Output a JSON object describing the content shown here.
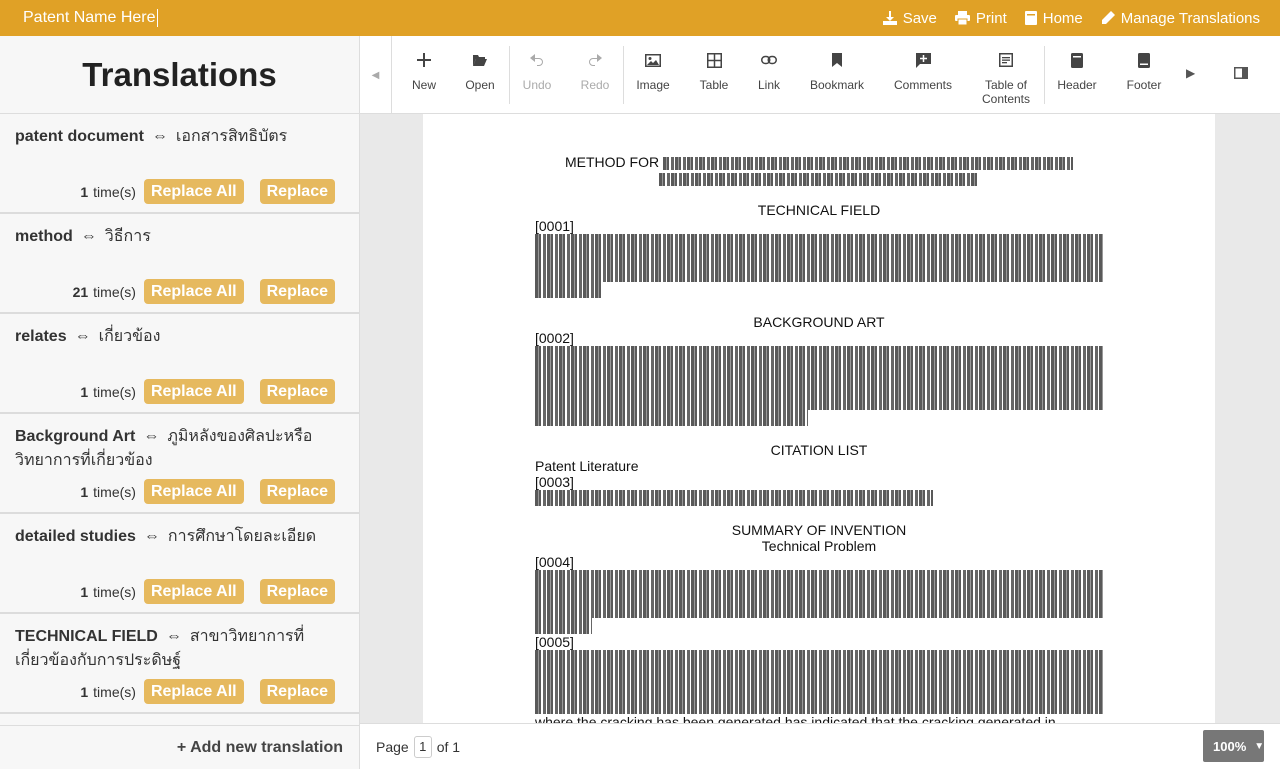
{
  "topbar": {
    "doc_name": "Patent Name Here",
    "save": "Save",
    "print": "Print",
    "home": "Home",
    "manage": "Manage Translations"
  },
  "sidebar": {
    "heading": "Translations",
    "items": [
      {
        "src": "patent document",
        "dst": "เอกสารสิทธิบัตร",
        "count": "1",
        "times": "time(s)"
      },
      {
        "src": "method",
        "dst": "วิธีการ",
        "count": "21",
        "times": "time(s)"
      },
      {
        "src": "relates",
        "dst": "เกี่ยวข้อง",
        "count": "1",
        "times": "time(s)"
      },
      {
        "src": "Background Art",
        "dst": "ภูมิหลังของศิลปะหรือวิทยาการที่เกี่ยวข้อง",
        "count": "1",
        "times": "time(s)"
      },
      {
        "src": "detailed studies",
        "dst": "การศึกษาโดยละเอียด",
        "count": "1",
        "times": "time(s)"
      },
      {
        "src": "TECHNICAL FIELD",
        "dst": "สาขาวิทยาการที่เกี่ยวข้องกับการประดิษฐ์",
        "count": "1",
        "times": "time(s)"
      }
    ],
    "arrow_symbol": "⇔",
    "replace_all": "Replace All",
    "replace": "Replace",
    "add_new": "+ Add new translation"
  },
  "toolbar": {
    "new": "New",
    "open": "Open",
    "undo": "Undo",
    "redo": "Redo",
    "image": "Image",
    "table": "Table",
    "link": "Link",
    "bookmark": "Bookmark",
    "comments": "Comments",
    "toc_line1": "Table of",
    "toc_line2": "Contents",
    "header": "Header",
    "footer": "Footer"
  },
  "document": {
    "title_visible": "METHOD FOR",
    "h_technical_field": "TECHNICAL FIELD",
    "p0001": "[0001]",
    "h_background": "BACKGROUND ART",
    "p0002": "[0002]",
    "h_citation": "CITATION LIST",
    "patent_literature": "Patent Literature",
    "p0003": "[0003]",
    "h_summary": "SUMMARY OF INVENTION",
    "h_technical_problem": "Technical Problem",
    "p0004": "[0004]",
    "p0005": "[0005]",
    "last_line": "where the cracking has been generated has indicated that the cracking generated in"
  },
  "statusbar": {
    "page_label": "Page",
    "page_value": "1",
    "of_label": "of 1",
    "zoom": "100%"
  }
}
